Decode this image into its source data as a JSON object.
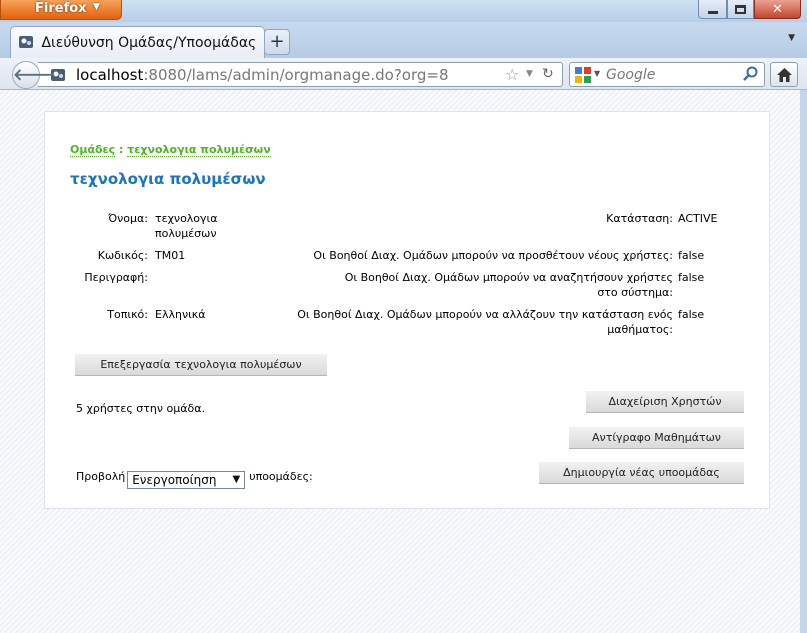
{
  "browser": {
    "menu_label": "Firefox",
    "tab_title": "Διεύθυνση Ομάδας/Υποομάδας",
    "newtab_label": "+",
    "url_host": "localhost",
    "url_rest": ":8080/lams/admin/orgmanage.do?org=8",
    "search_placeholder": "Google",
    "close_label": "✕"
  },
  "page": {
    "breadcrumb_root": "Ομάδες",
    "breadcrumb_sep": " : ",
    "breadcrumb_current": "τεχνολογια πολυμέσων",
    "title": "τεχνολογια πολυμέσων",
    "fields": {
      "name_label": "Όνομα:",
      "name_value": "τεχνολογια πολυμέσων",
      "code_label": "Κωδικός:",
      "code_value": "TM01",
      "description_label": "Περιγραφή:",
      "description_value": "",
      "locale_label": "Τοπικό:",
      "locale_value": "Ελληνικά",
      "status_label": "Κατάσταση:",
      "status_value": "ACTIVE",
      "add_users_label": "Οι Βοηθοί Διαχ. Ομάδων μπορούν να προσθέτουν νέους χρήστες:",
      "add_users_value": "false",
      "search_users_label": "Οι Βοηθοί Διαχ. Ομάδων μπορούν να αναζητήσουν χρήστες στο σύστημα:",
      "search_users_value": "false",
      "change_status_label": "Οι Βοηθοί Διαχ. Ομάδων μπορούν να αλλάζουν την κατάσταση ενός μαθήματος:",
      "change_status_value": "false"
    },
    "edit_button": "Επεξεργασία τεχνολογια πολυμέσων",
    "users_count_text": "5 χρήστες στην ομάδα.",
    "manage_users_button": "Διαχείριση Χρηστών",
    "copy_lessons_button": "Αντίγραφο Μαθημάτων",
    "create_subgroup_button": "Δημιουργία νέας υποομάδας",
    "view_prefix": "Προβολή",
    "view_selected": "Ενεργοποίηση",
    "view_suffix": "υποομάδες:"
  }
}
